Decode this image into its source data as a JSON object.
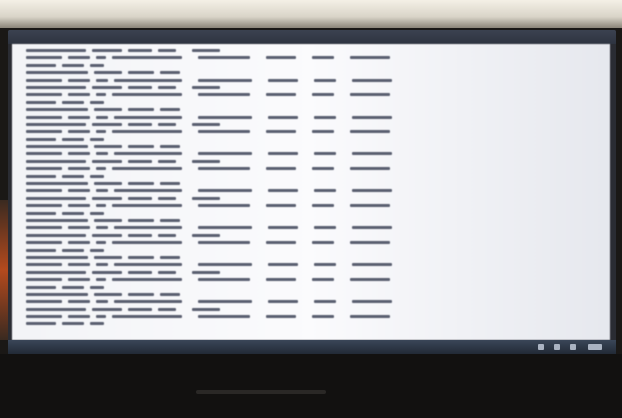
{
  "window": {
    "title": ""
  },
  "colors": {
    "editor_bg": "#f7f8fb",
    "text": "#3a3d48",
    "taskbar": "#2b3443",
    "bezel": "#121110"
  },
  "editor": {
    "line_count": 38
  },
  "taskbar": {
    "icons": [
      "network-icon",
      "volume-icon",
      "battery-icon",
      "clock-icon"
    ]
  }
}
